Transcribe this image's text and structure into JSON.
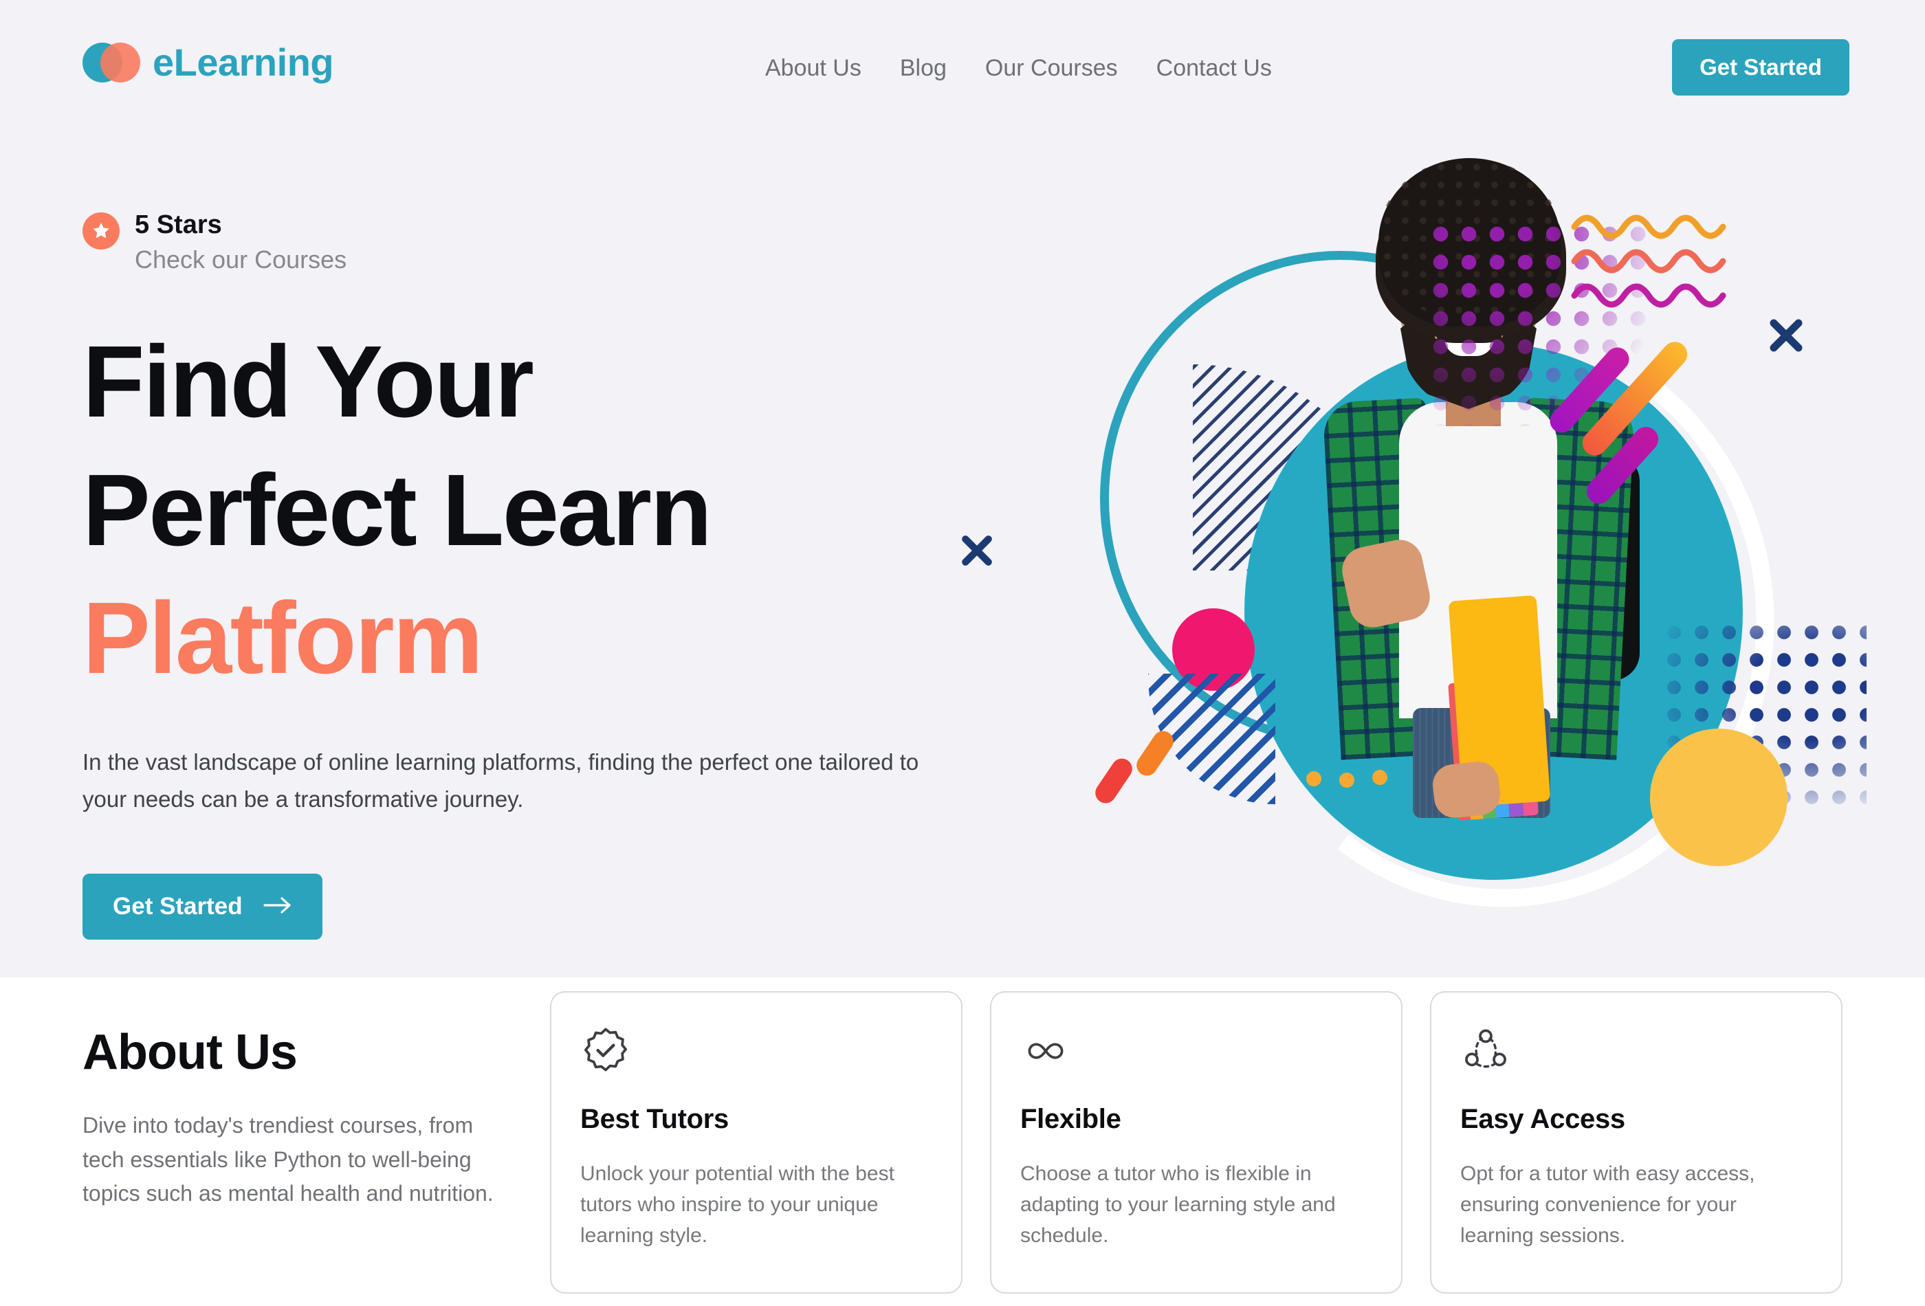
{
  "brand": {
    "name": "eLearning",
    "logo_icon": "two-overlapping-circles-logo",
    "color_teal": "#2ba3bd",
    "color_orange": "#fa7b5e"
  },
  "nav": {
    "items": [
      {
        "label": "About Us"
      },
      {
        "label": "Blog"
      },
      {
        "label": "Our Courses"
      },
      {
        "label": "Contact Us"
      }
    ],
    "cta_label": "Get Started"
  },
  "hero": {
    "rating_badge_icon": "star-icon",
    "rating_title": "5 Stars",
    "rating_subtitle": "Check our Courses",
    "headline_line1": "Find Your",
    "headline_line2": "Perfect Learn",
    "headline_accent": "Platform",
    "description": "In the vast landscape of online learning platforms, finding the perfect one tailored to your needs can be a transformative journey.",
    "cta_label": "Get Started",
    "cta_icon": "arrow-right-icon",
    "background_color": "#f2f2f7",
    "illustration": {
      "alt": "smiling student with curly hair holding folder and books with backpack",
      "shapes": [
        "teal-ring-outline",
        "teal-circle",
        "white-ring-arc",
        "pink-circle",
        "yellow-circle",
        "navy-stripe-fan",
        "purple-dot-grid",
        "navy-dot-grid",
        "white-dot-grid",
        "wavy-lines",
        "diagonal-bars",
        "x-marks",
        "orange-pills"
      ],
      "colors": {
        "teal": "#26aac4",
        "pink": "#f0186e",
        "yellow": "#fbc24a",
        "navy": "#1e3a8a",
        "purple": "#9b1fb5",
        "orange": "#f58025",
        "red": "#ef4039"
      }
    }
  },
  "about": {
    "title": "About Us",
    "description": "Dive into today's trendiest courses, from tech essentials like Python to well-being topics such as mental health and nutrition.",
    "cards": [
      {
        "icon": "verified-badge-check-icon",
        "title": "Best Tutors",
        "description": "Unlock your potential with the best tutors who inspire to your unique learning style."
      },
      {
        "icon": "infinity-icon",
        "title": "Flexible",
        "description": "Choose a tutor who is flexible in adapting to your learning style and schedule."
      },
      {
        "icon": "share-network-icon",
        "title": "Easy Access",
        "description": "Opt for a tutor with easy access, ensuring convenience for your learning sessions."
      }
    ]
  }
}
